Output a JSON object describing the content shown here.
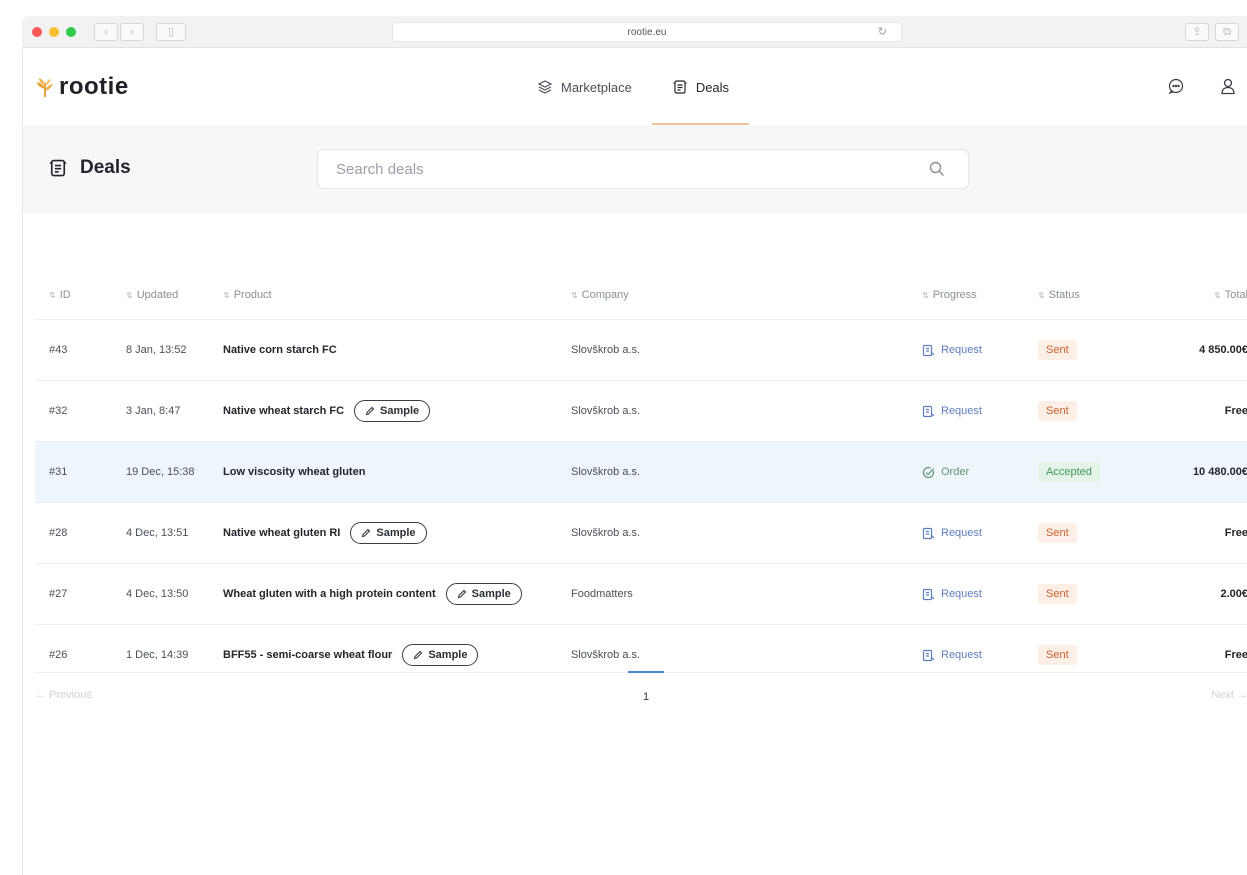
{
  "browser": {
    "url": "rootie.eu",
    "back_glyph": "‹",
    "forward_glyph": "›",
    "sidebar_glyph": "▯",
    "reload_glyph": "↻",
    "share_glyph": "⇪",
    "tabs_glyph": "⧉"
  },
  "header": {
    "logo": "rootie",
    "nav": [
      {
        "label": "Marketplace",
        "icon": "layers-icon"
      },
      {
        "label": "Deals",
        "icon": "deals-icon",
        "active": true
      }
    ],
    "icons": [
      "chat-icon",
      "user-icon"
    ]
  },
  "toolbar": {
    "title": "Deals",
    "search_placeholder": "Search deals"
  },
  "table": {
    "columns": [
      "ID",
      "Updated",
      "Product",
      "Company",
      "Progress",
      "Status",
      "Total"
    ],
    "rows": [
      {
        "id": "#43",
        "updated": "8 Jan, 13:52",
        "product": "Native corn starch FC",
        "sample": "",
        "company": "Slovškrob a.s.",
        "progress": "Request",
        "status": "Sent",
        "total": "4 850.00€"
      },
      {
        "id": "#32",
        "updated": "3 Jan, 8:47",
        "product": "Native wheat starch FC",
        "sample": "Sample",
        "company": "Slovškrob a.s.",
        "progress": "Request",
        "status": "Sent",
        "total": "Free"
      },
      {
        "id": "#31",
        "updated": "19 Dec, 15:38",
        "product": "Low viscosity wheat gluten",
        "sample": "",
        "company": "Slovškrob a.s.",
        "progress": "Order",
        "status": "Accepted",
        "total": "10 480.00€"
      },
      {
        "id": "#28",
        "updated": "4 Dec, 13:51",
        "product": "Native wheat gluten RI",
        "sample": "Sample",
        "company": "Slovškrob a.s.",
        "progress": "Request",
        "status": "Sent",
        "total": "Free"
      },
      {
        "id": "#27",
        "updated": "4 Dec, 13:50",
        "product": "Wheat gluten with a high protein content",
        "sample": "Sample",
        "company": "Foodmatters",
        "progress": "Request",
        "status": "Sent",
        "total": "2.00€"
      },
      {
        "id": "#26",
        "updated": "1 Dec, 14:39",
        "product": "BFF55 - semi-coarse wheat flour",
        "sample": "Sample",
        "company": "Slovškrob a.s.",
        "progress": "Request",
        "status": "Sent",
        "total": "Free"
      }
    ]
  },
  "pagination": {
    "previous": "← Previous",
    "current": "1",
    "next": "Next →"
  },
  "colors": {
    "accent_tab": "#f1c69b",
    "sent_bg": "#fdeee6",
    "sent_text": "#c8602e",
    "accepted_bg": "#e3f3e7",
    "accepted_text": "#3d9a5a",
    "request_blue": "#5d7ec0",
    "highlight_row": "#eef5fb",
    "page_indicator": "#4f86d6"
  }
}
